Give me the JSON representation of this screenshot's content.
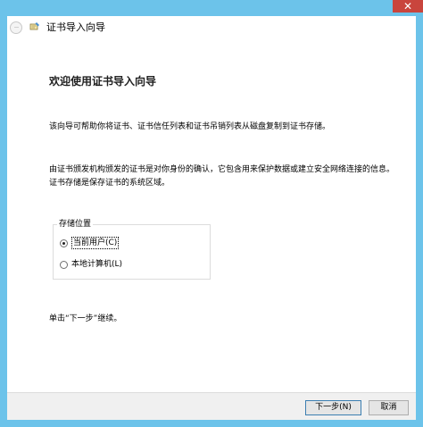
{
  "window": {
    "close_glyph": "✕",
    "accent_color": "#6cc3ea"
  },
  "wizard": {
    "title": "证书导入向导",
    "heading": "欢迎使用证书导入向导",
    "intro": "该向导可帮助你将证书、证书信任列表和证书吊销列表从磁盘复制到证书存储。",
    "description": "由证书颁发机构颁发的证书是对你身份的确认，它包含用来保护数据或建立安全网络连接的信息。证书存储是保存证书的系统区域。",
    "continue_hint": "单击“下一步”继续。"
  },
  "store_location": {
    "label": "存储位置",
    "options": [
      {
        "label": "当前用户(C)",
        "checked": true
      },
      {
        "label": "本地计算机(L)",
        "checked": false
      }
    ]
  },
  "buttons": {
    "next": "下一步(N)",
    "cancel": "取消"
  }
}
